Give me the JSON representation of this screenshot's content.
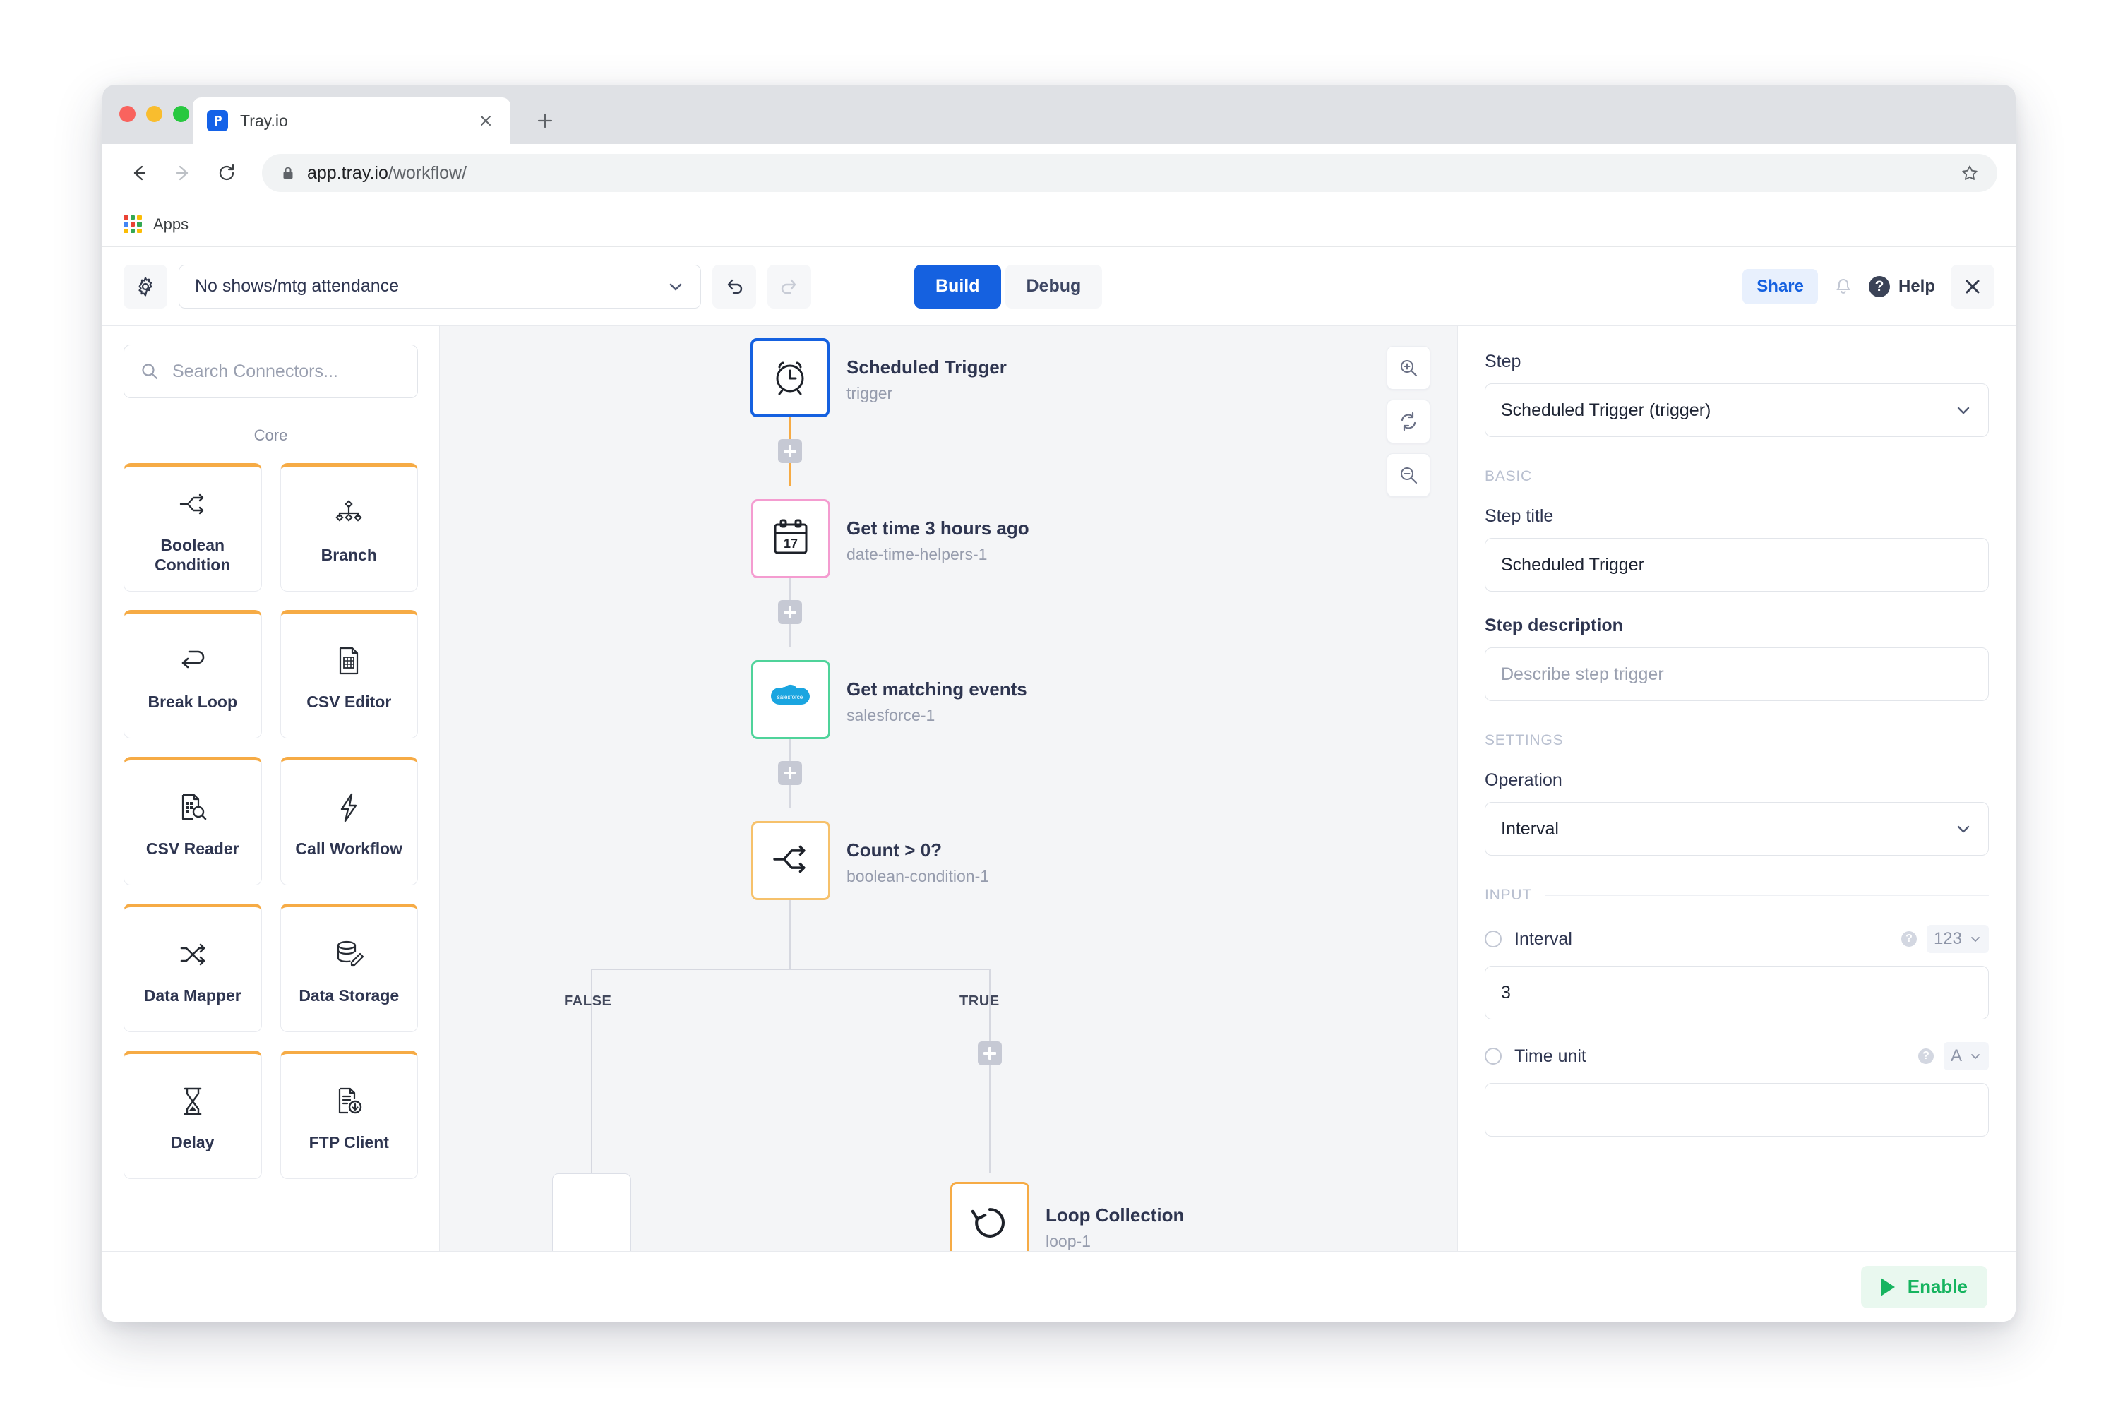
{
  "browser": {
    "tab": {
      "title": "Tray.io",
      "favicon": "tray-logo-icon",
      "close": "×"
    },
    "new_tab_label": "+",
    "url_host": "app.tray.io",
    "url_path": "/workflow/",
    "bookmark_label": "Apps"
  },
  "toolbar": {
    "settings_icon": "gear-icon",
    "workflow_name": "No shows/mtg attendance",
    "undo_icon": "undo-icon",
    "redo_icon": "redo-icon",
    "modes": [
      {
        "label": "Build",
        "active": true
      },
      {
        "label": "Debug",
        "active": false
      }
    ],
    "share_label": "Share",
    "bell_icon": "bell-icon",
    "help_label": "Help",
    "help_mark": "?",
    "close_icon": "close-icon"
  },
  "connectors_panel": {
    "search_placeholder": "Search Connectors...",
    "group_label": "Core",
    "items": [
      {
        "label": "Boolean Condition",
        "icon": "boolean-condition-icon"
      },
      {
        "label": "Branch",
        "icon": "branch-icon"
      },
      {
        "label": "Break Loop",
        "icon": "break-loop-icon"
      },
      {
        "label": "CSV Editor",
        "icon": "csv-editor-icon"
      },
      {
        "label": "CSV Reader",
        "icon": "csv-reader-icon"
      },
      {
        "label": "Call Workflow",
        "icon": "call-workflow-icon"
      },
      {
        "label": "Data Mapper",
        "icon": "data-mapper-icon"
      },
      {
        "label": "Data Storage",
        "icon": "data-storage-icon"
      },
      {
        "label": "Delay",
        "icon": "delay-icon"
      },
      {
        "label": "FTP Client",
        "icon": "ftp-client-icon"
      }
    ]
  },
  "canvas": {
    "zoom_in_icon": "zoom-in-icon",
    "reset_zoom_icon": "reset-zoom-icon",
    "zoom_out_icon": "zoom-out-icon",
    "nodes": [
      {
        "title": "Scheduled Trigger",
        "subtitle": "trigger",
        "icon": "alarm-clock-icon",
        "border": "#1561e0"
      },
      {
        "title": "Get time 3 hours ago",
        "subtitle": "date-time-helpers-1",
        "icon": "calendar-17-icon",
        "border": "#f49cd0"
      },
      {
        "title": "Get matching events",
        "subtitle": "salesforce-1",
        "icon": "salesforce-cloud-icon",
        "border": "#4fd39a"
      },
      {
        "title": "Count > 0?",
        "subtitle": "boolean-condition-1",
        "icon": "boolean-condition-icon",
        "border": "#f6c16b"
      },
      {
        "title": "Loop Collection",
        "subtitle": "loop-1",
        "icon": "loop-collection-icon",
        "border": "#f6ab45"
      }
    ],
    "branch_labels": {
      "false": "FALSE",
      "true": "TRUE"
    },
    "add_step_icon": "plus-icon"
  },
  "properties": {
    "step_label": "Step",
    "step_value": "Scheduled Trigger (trigger)",
    "basic_section": "BASIC",
    "step_title_label": "Step title",
    "step_title_value": "Scheduled Trigger",
    "step_description_label": "Step description",
    "step_description_placeholder": "Describe step trigger",
    "settings_section": "SETTINGS",
    "operation_label": "Operation",
    "operation_value": "Interval",
    "input_section": "INPUT",
    "fields": [
      {
        "label": "Interval",
        "type_badge": "123",
        "value": "3",
        "help": "?"
      },
      {
        "label": "Time unit",
        "type_badge": "A",
        "value": "",
        "help": "?"
      }
    ]
  },
  "footer": {
    "enable_label": "Enable",
    "enable_icon": "play-icon"
  },
  "colors": {
    "accent_blue": "#1561e0",
    "amber": "#f6ab45",
    "green": "#16b45f",
    "canvas_bg": "#f4f5f7"
  }
}
